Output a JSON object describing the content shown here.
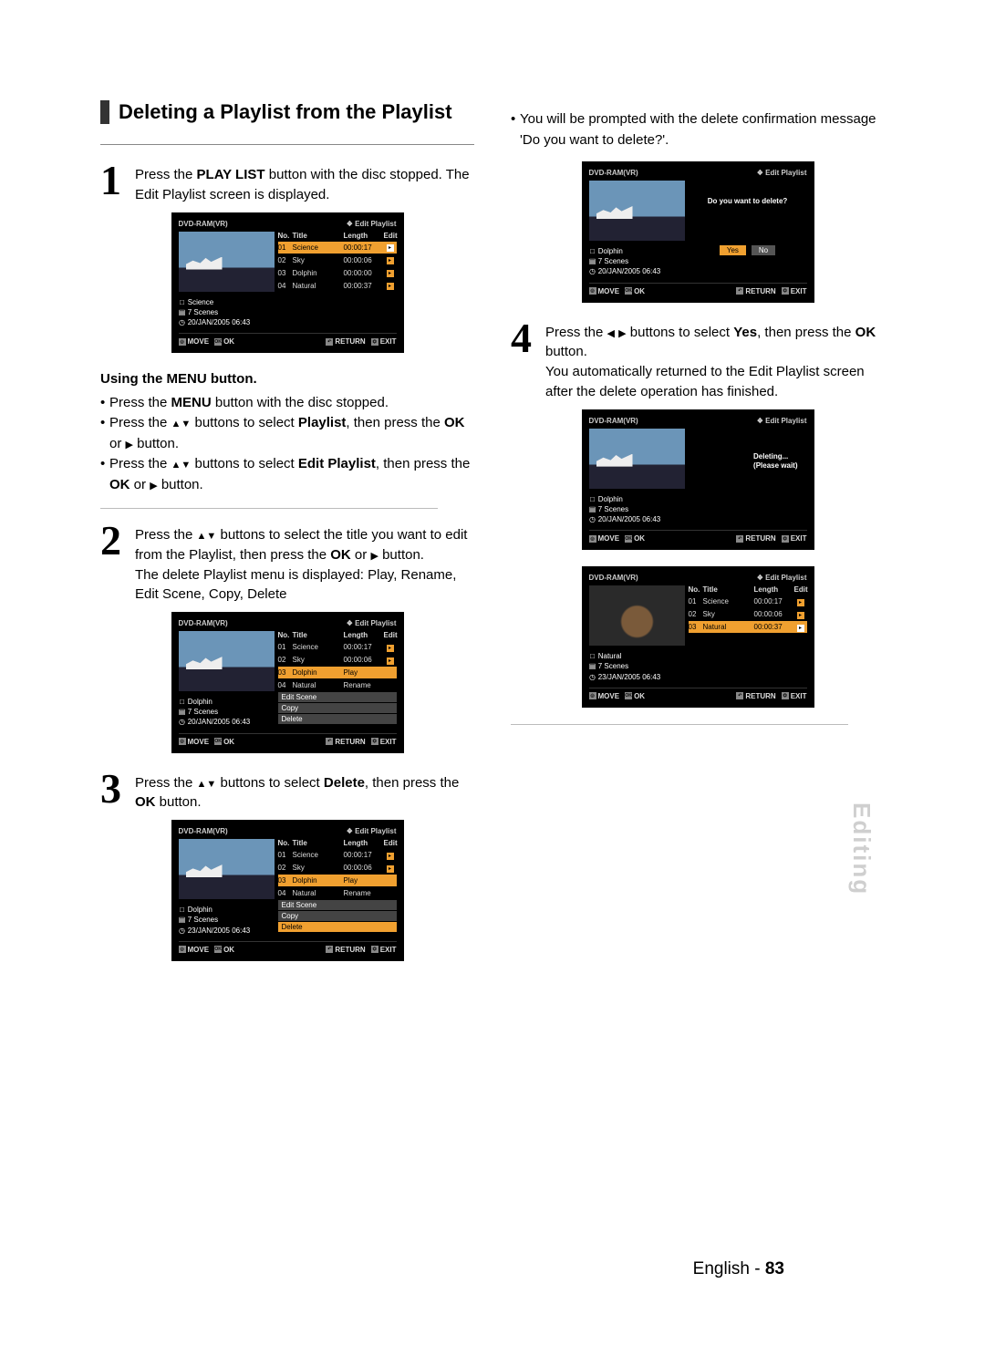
{
  "section_title": "Deleting a Playlist from the Playlist",
  "steps": {
    "s1": {
      "num": "1",
      "t1": "Press the ",
      "b1": "PLAY LIST",
      "t2": " button with the disc stopped. The Edit Playlist screen is displayed."
    },
    "s2": {
      "num": "2",
      "t1": "Press the ",
      "t2": " buttons to select the title you want to edit from the Playlist, then press the ",
      "b1": "OK",
      "t3": " or ",
      "t4": " button.",
      "line2": "The delete Playlist menu is displayed: Play, Rename, Edit Scene, Copy, Delete"
    },
    "s3": {
      "num": "3",
      "t1": "Press the ",
      "t2": " buttons to select ",
      "b1": "Delete",
      "t3": ", then press the ",
      "b2": "OK",
      "t4": " button."
    },
    "s4": {
      "num": "4",
      "t1": "Press the ",
      "t2": " buttons to select ",
      "b1": "Yes",
      "t3": ", then press the ",
      "b2": "OK",
      "t4": " button.",
      "line2": "You automatically returned to the Edit Playlist screen after the delete operation has finished."
    }
  },
  "menu_block": {
    "subhead": "Using the MENU button.",
    "b1_a": "Press the ",
    "b1_bold": "MENU",
    "b1_b": " button with the disc stopped.",
    "b2_a": "Press the ",
    "b2_b": " buttons to select ",
    "b2_bold": "Playlist",
    "b2_c": ", then press the ",
    "b2_bold2": "OK",
    "b2_d": " or ",
    "b2_e": " button.",
    "b3_a": "Press the ",
    "b3_b": " buttons to select ",
    "b3_bold": "Edit Playlist",
    "b3_c": ", then press the ",
    "b3_bold2": "OK",
    "b3_d": " or ",
    "b3_e": " button."
  },
  "prompt_bullet": {
    "a": "You will be prompted with the delete confirmation message 'Do you want to delete?'."
  },
  "osd_common": {
    "disc": "DVD-RAM(VR)",
    "title_label": "Edit Playlist",
    "hdr_no": "No.",
    "hdr_title": "Title",
    "hdr_len": "Length",
    "hdr_edit": "Edit",
    "foot_move": "MOVE",
    "foot_ok": "OK",
    "foot_return": "RETURN",
    "foot_exit": "EXIT"
  },
  "osd1": {
    "meta_title": "Science",
    "meta_scenes": "7 Scenes",
    "meta_date": "20/JAN/2005 06:43",
    "rows": [
      {
        "no": "01",
        "title": "Science",
        "len": "00:00:17"
      },
      {
        "no": "02",
        "title": "Sky",
        "len": "00:00:06"
      },
      {
        "no": "03",
        "title": "Dolphin",
        "len": "00:00:00"
      },
      {
        "no": "04",
        "title": "Natural",
        "len": "00:00:37"
      }
    ],
    "sel": 0
  },
  "osd2": {
    "meta_title": "Dolphin",
    "meta_scenes": "7 Scenes",
    "meta_date": "20/JAN/2005 06:43",
    "rows": [
      {
        "no": "01",
        "title": "Science",
        "len": "00:00:17"
      },
      {
        "no": "02",
        "title": "Sky",
        "len": "00:00:06"
      },
      {
        "no": "03",
        "title": "Dolphin",
        "len": ""
      },
      {
        "no": "04",
        "title": "Natural",
        "len": ""
      }
    ],
    "menu": [
      "Play",
      "Rename",
      "Edit Scene",
      "Copy",
      "Delete"
    ],
    "sel": 2
  },
  "osd3": {
    "meta_title": "Dolphin",
    "meta_scenes": "7 Scenes",
    "meta_date": "23/JAN/2005 06:43",
    "rows": [
      {
        "no": "01",
        "title": "Science",
        "len": "00:00:17"
      },
      {
        "no": "02",
        "title": "Sky",
        "len": "00:00:06"
      },
      {
        "no": "03",
        "title": "Dolphin",
        "len": ""
      },
      {
        "no": "04",
        "title": "Natural",
        "len": ""
      }
    ],
    "menu": [
      "Play",
      "Rename",
      "Edit Scene",
      "Copy",
      "Delete"
    ],
    "menu_sel": 4,
    "sel": 2
  },
  "osd4": {
    "meta_title": "Dolphin",
    "meta_scenes": "7 Scenes",
    "meta_date": "20/JAN/2005 06:43",
    "prompt": "Do you want to delete?",
    "yes": "Yes",
    "no": "No"
  },
  "osd5": {
    "meta_title": "Dolphin",
    "meta_scenes": "7 Scenes",
    "meta_date": "20/JAN/2005 06:43",
    "msg1": "Deleting...",
    "msg2": "(Please wait)"
  },
  "osd6": {
    "meta_title": "Natural",
    "meta_scenes": "7 Scenes",
    "meta_date": "23/JAN/2005 06:43",
    "rows": [
      {
        "no": "01",
        "title": "Science",
        "len": "00:00:17"
      },
      {
        "no": "02",
        "title": "Sky",
        "len": "00:00:06"
      },
      {
        "no": "03",
        "title": "Natural",
        "len": "00:00:37"
      }
    ],
    "sel": 2
  },
  "side_tab": "Editing",
  "footer_lang": "English - ",
  "footer_page": "83"
}
